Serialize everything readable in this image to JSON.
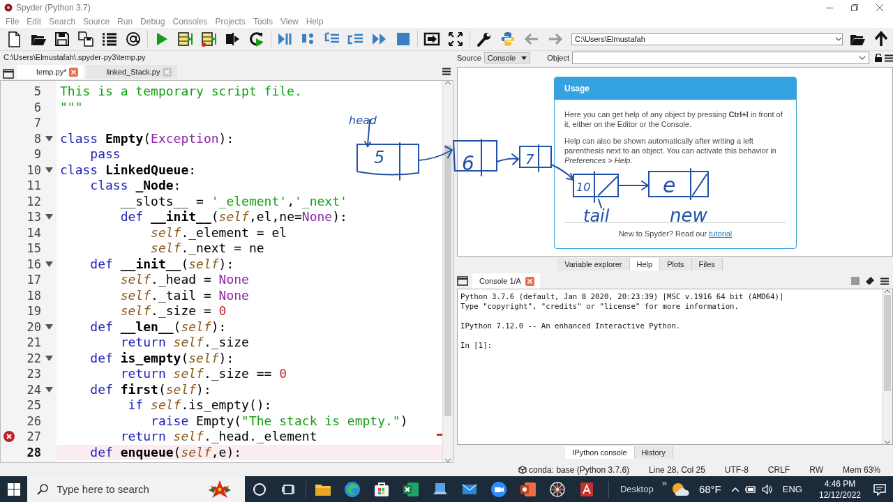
{
  "window": {
    "title": "Spyder (Python 3.7)"
  },
  "menu": [
    "File",
    "Edit",
    "Search",
    "Source",
    "Run",
    "Debug",
    "Consoles",
    "Projects",
    "Tools",
    "View",
    "Help"
  ],
  "working_directory": {
    "value": "C:\\Users\\Elmustafah"
  },
  "editor": {
    "file_path": "C:\\Users\\Elmustafah\\.spyder-py3\\temp.py",
    "tabs": [
      {
        "label": "temp.py*",
        "selected": true
      },
      {
        "label": "linked_Stack.py",
        "selected": false
      }
    ],
    "lines": [
      {
        "number": "5",
        "fold": false,
        "error": false,
        "current": false,
        "tokens": [
          {
            "kind": "doc",
            "text": "This is a temporary script file."
          }
        ]
      },
      {
        "number": "6",
        "fold": false,
        "error": false,
        "current": false,
        "tokens": [
          {
            "kind": "doc",
            "text": "\"\"\""
          }
        ]
      },
      {
        "number": "7",
        "fold": false,
        "error": false,
        "current": false
      },
      {
        "number": "8",
        "fold": true,
        "error": false,
        "current": false,
        "tokens": [
          {
            "kind": "kw",
            "text": "class "
          },
          {
            "kind": "def",
            "text": "Empty"
          },
          {
            "kind": "plain",
            "text": "("
          },
          {
            "kind": "const",
            "text": "Exception"
          },
          {
            "kind": "plain",
            "text": "):"
          }
        ]
      },
      {
        "number": "9",
        "fold": false,
        "error": false,
        "current": false,
        "tokens": [
          {
            "kind": "kw",
            "text": "    pass"
          }
        ]
      },
      {
        "number": "10",
        "fold": true,
        "error": false,
        "current": false,
        "tokens": [
          {
            "kind": "kw",
            "text": "class "
          },
          {
            "kind": "def",
            "text": "LinkedQueue"
          },
          {
            "kind": "plain",
            "text": ":"
          }
        ]
      },
      {
        "number": "11",
        "fold": false,
        "error": false,
        "current": false,
        "tokens": [
          {
            "kind": "kw",
            "text": "    class "
          },
          {
            "kind": "def",
            "text": "_Node"
          },
          {
            "kind": "plain",
            "text": ":"
          }
        ]
      },
      {
        "number": "12",
        "fold": false,
        "error": false,
        "current": false,
        "tokens": [
          {
            "kind": "plain",
            "text": "        __slots__ = "
          },
          {
            "kind": "str",
            "text": "'_element'"
          },
          {
            "kind": "plain",
            "text": ","
          },
          {
            "kind": "str",
            "text": "'_next'"
          }
        ]
      },
      {
        "number": "13",
        "fold": true,
        "error": false,
        "current": false,
        "tokens": [
          {
            "kind": "kw",
            "text": "        def "
          },
          {
            "kind": "def",
            "text": "__init__"
          },
          {
            "kind": "plain",
            "text": "("
          },
          {
            "kind": "self",
            "text": "self"
          },
          {
            "kind": "plain",
            "text": ",el,ne="
          },
          {
            "kind": "const",
            "text": "None"
          },
          {
            "kind": "plain",
            "text": "):"
          }
        ]
      },
      {
        "number": "14",
        "fold": false,
        "error": false,
        "current": false,
        "tokens": [
          {
            "kind": "self",
            "text": "            self"
          },
          {
            "kind": "plain",
            "text": "._element = el"
          }
        ]
      },
      {
        "number": "15",
        "fold": false,
        "error": false,
        "current": false,
        "tokens": [
          {
            "kind": "self",
            "text": "            self"
          },
          {
            "kind": "plain",
            "text": "._next = ne"
          }
        ]
      },
      {
        "number": "16",
        "fold": true,
        "error": false,
        "current": false,
        "tokens": [
          {
            "kind": "kw",
            "text": "    def "
          },
          {
            "kind": "def",
            "text": "__init__"
          },
          {
            "kind": "plain",
            "text": "("
          },
          {
            "kind": "self",
            "text": "self"
          },
          {
            "kind": "plain",
            "text": "):"
          }
        ]
      },
      {
        "number": "17",
        "fold": false,
        "error": false,
        "current": false,
        "tokens": [
          {
            "kind": "self",
            "text": "        self"
          },
          {
            "kind": "plain",
            "text": "._head = "
          },
          {
            "kind": "const",
            "text": "None"
          }
        ]
      },
      {
        "number": "18",
        "fold": false,
        "error": false,
        "current": false,
        "tokens": [
          {
            "kind": "self",
            "text": "        self"
          },
          {
            "kind": "plain",
            "text": "._tail = "
          },
          {
            "kind": "const",
            "text": "None"
          }
        ]
      },
      {
        "number": "19",
        "fold": false,
        "error": false,
        "current": false,
        "tokens": [
          {
            "kind": "self",
            "text": "        self"
          },
          {
            "kind": "plain",
            "text": "._size = "
          },
          {
            "kind": "num",
            "text": "0"
          }
        ]
      },
      {
        "number": "20",
        "fold": true,
        "error": false,
        "current": false,
        "tokens": [
          {
            "kind": "kw",
            "text": "    def "
          },
          {
            "kind": "def",
            "text": "__len__"
          },
          {
            "kind": "plain",
            "text": "("
          },
          {
            "kind": "self",
            "text": "self"
          },
          {
            "kind": "plain",
            "text": "):"
          }
        ]
      },
      {
        "number": "21",
        "fold": false,
        "error": false,
        "current": false,
        "tokens": [
          {
            "kind": "kw",
            "text": "        return "
          },
          {
            "kind": "self",
            "text": "self"
          },
          {
            "kind": "plain",
            "text": "._size"
          }
        ]
      },
      {
        "number": "22",
        "fold": true,
        "error": false,
        "current": false,
        "tokens": [
          {
            "kind": "kw",
            "text": "    def "
          },
          {
            "kind": "def",
            "text": "is_empty"
          },
          {
            "kind": "plain",
            "text": "("
          },
          {
            "kind": "self",
            "text": "self"
          },
          {
            "kind": "plain",
            "text": "):"
          }
        ]
      },
      {
        "number": "23",
        "fold": false,
        "error": false,
        "current": false,
        "tokens": [
          {
            "kind": "kw",
            "text": "        return "
          },
          {
            "kind": "self",
            "text": "self"
          },
          {
            "kind": "plain",
            "text": "._size == "
          },
          {
            "kind": "num",
            "text": "0"
          }
        ]
      },
      {
        "number": "24",
        "fold": true,
        "error": false,
        "current": false,
        "tokens": [
          {
            "kind": "kw",
            "text": "    def "
          },
          {
            "kind": "def",
            "text": "first"
          },
          {
            "kind": "plain",
            "text": "("
          },
          {
            "kind": "self",
            "text": "self"
          },
          {
            "kind": "plain",
            "text": "):"
          }
        ]
      },
      {
        "number": "25",
        "fold": false,
        "error": false,
        "current": false,
        "tokens": [
          {
            "kind": "kw",
            "text": "         if "
          },
          {
            "kind": "self",
            "text": "self"
          },
          {
            "kind": "plain",
            "text": ".is_empty():"
          }
        ]
      },
      {
        "number": "26",
        "fold": false,
        "error": false,
        "current": false,
        "tokens": [
          {
            "kind": "kw",
            "text": "            raise"
          },
          {
            "kind": "plain",
            "text": " Empty("
          },
          {
            "kind": "str",
            "text": "\"The stack is empty.\""
          },
          {
            "kind": "plain",
            "text": ")"
          }
        ]
      },
      {
        "number": "27",
        "fold": false,
        "error": true,
        "current": false,
        "tokens": [
          {
            "kind": "kw",
            "text": "        return "
          },
          {
            "kind": "self",
            "text": "self"
          },
          {
            "kind": "plain",
            "text": "._head._element"
          }
        ]
      },
      {
        "number": "28",
        "fold": false,
        "error": false,
        "current": true,
        "tokens": [
          {
            "kind": "kw",
            "text": "    def "
          },
          {
            "kind": "def",
            "text": "enqueue"
          },
          {
            "kind": "plain",
            "text": "("
          },
          {
            "kind": "self",
            "text": "self"
          },
          {
            "kind": "plain",
            "text": ",e):"
          }
        ]
      }
    ]
  },
  "help": {
    "source_label": "Source",
    "source_value": "Console",
    "object_label": "Object",
    "usage": {
      "title": "Usage",
      "paragraphs": [
        "Here you can get help of any object by pressing **Ctrl+I** in front of it, either on the Editor or the Console.",
        "Help can also be shown automatically after writing a left parenthesis next to an object. You can activate this behavior in *Preferences > Help*."
      ],
      "footer": "New to Spyder? Read our",
      "link": "tutorial"
    },
    "annotations": [
      "head",
      "5",
      "6",
      "7",
      "10",
      "tail",
      "e",
      "new"
    ]
  },
  "pane_tabs": [
    {
      "label": "Variable explorer",
      "selected": false
    },
    {
      "label": "Help",
      "selected": true
    },
    {
      "label": "Plots",
      "selected": false
    },
    {
      "label": "Files",
      "selected": false
    }
  ],
  "console": {
    "tab": "Console 1/A",
    "blocks": [
      [
        "Python 3.7.6 (default, Jan  8 2020, 20:23:39) [MSC v.1916 64 bit (AMD64)]",
        "Type \"copyright\", \"credits\" or \"license\" for more information."
      ],
      [
        "IPython 7.12.0 -- An enhanced Interactive Python."
      ],
      [
        "In [1]:"
      ]
    ]
  },
  "console_tabs": [
    {
      "label": "IPython console",
      "selected": true
    },
    {
      "label": "History",
      "selected": false
    }
  ],
  "status_bar": [
    "conda: base (Python 3.7.6)",
    "Line 28, Col 25",
    "UTF-8",
    "CRLF",
    "RW",
    "Mem 63%"
  ],
  "taskbar": {
    "search_placeholder": "Type here to search",
    "desktop_label": "Desktop",
    "overflow": "»",
    "weather": "68°F",
    "language": "ENG",
    "time": "4:46 PM",
    "date": "12/12/2022"
  }
}
